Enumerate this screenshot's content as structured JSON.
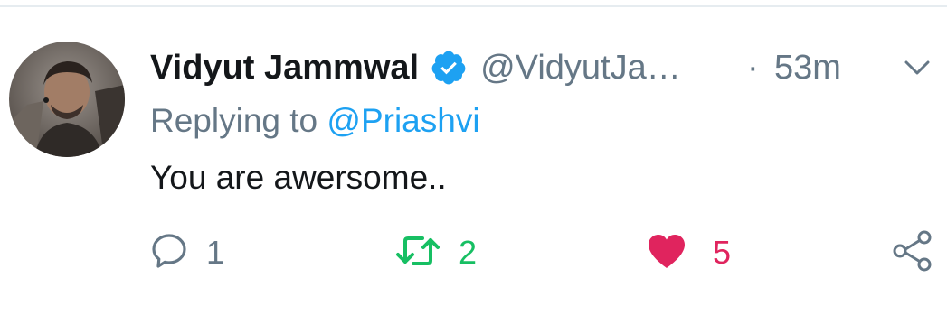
{
  "tweet": {
    "author": {
      "display_name": "Vidyut Jammwal",
      "handle": "@VidyutJa…",
      "verified": true
    },
    "separator": "·",
    "time": "53m",
    "replying_prefix": "Replying to",
    "replying_to": "@Priashvi",
    "text": "You are awersome..",
    "actions": {
      "reply_count": "1",
      "retweet_count": "2",
      "like_count": "5",
      "liked": true
    },
    "icons": {
      "verified": "verified-badge-icon",
      "caret": "chevron-down-icon",
      "reply": "reply-bubble-icon",
      "retweet": "retweet-icon",
      "like": "heart-icon",
      "share": "share-icon"
    }
  },
  "colors": {
    "brand_blue": "#1da1f2",
    "secondary_text": "#657786",
    "primary_text": "#14171a",
    "retweet_green": "#17bf63",
    "like_red": "#e0245e",
    "divider": "#e6ecf0"
  }
}
